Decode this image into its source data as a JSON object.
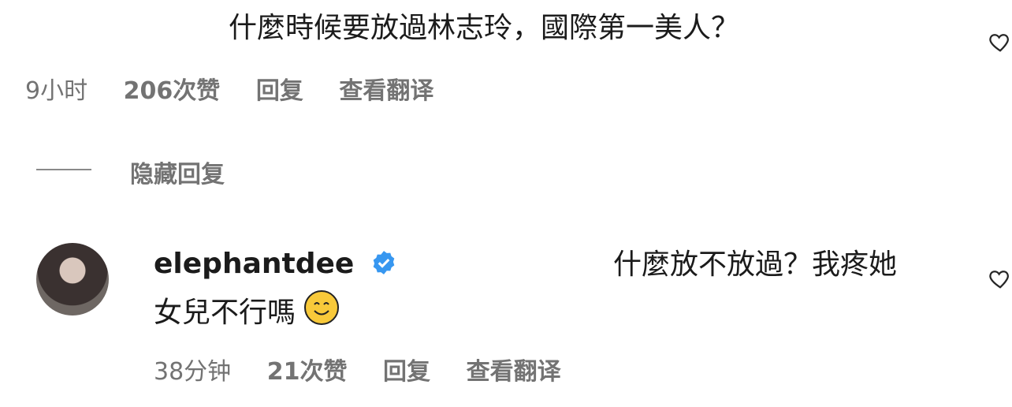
{
  "comment1": {
    "text": "什麼時候要放過林志玲，國際第一美人？",
    "time": "9小时",
    "likes": "206次赞",
    "reply": "回复",
    "translate": "查看翻译"
  },
  "hide_replies": "隐藏回复",
  "comment2": {
    "username": "elephantdee",
    "text_line1": "什麼放不放過？我疼她",
    "text_line2": "女兒不行嗎",
    "time": "38分钟",
    "likes": "21次赞",
    "reply": "回复",
    "translate": "查看翻译"
  },
  "icons": {
    "like": "heart-outline-icon",
    "verified": "verified-badge-icon",
    "emoji": "smiling-face-emoji"
  },
  "colors": {
    "verified": "#3797f0",
    "meta": "#737373"
  }
}
